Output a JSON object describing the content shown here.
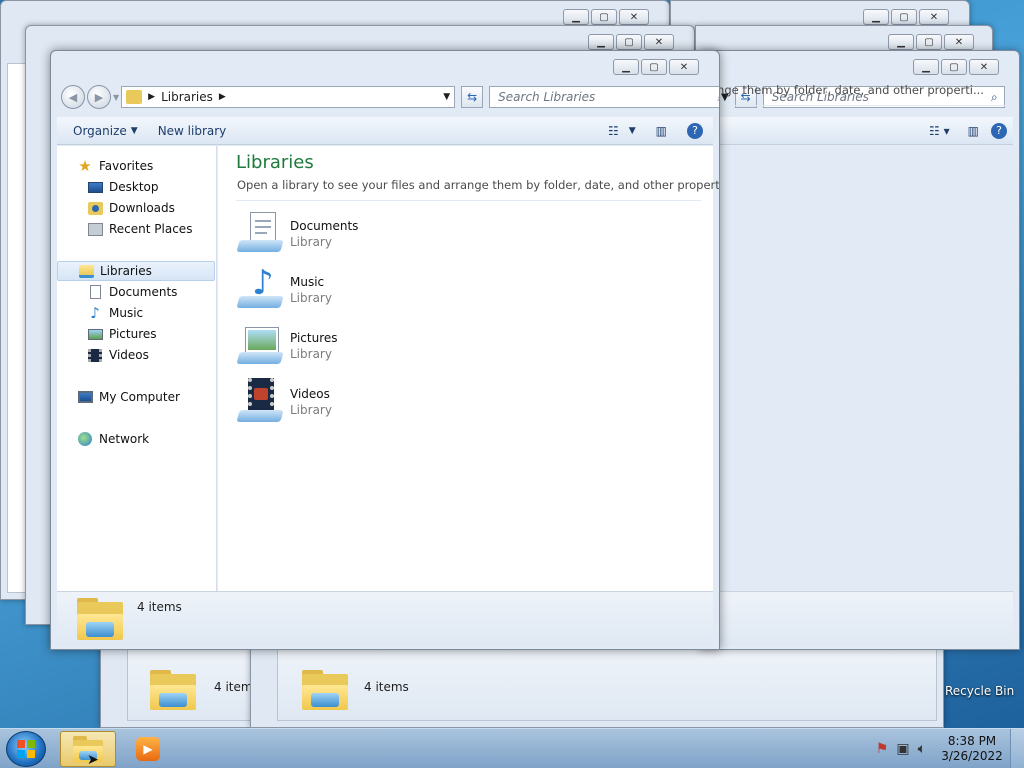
{
  "desktop": {
    "recycle_bin_label": "Recycle Bin"
  },
  "background_windows": {
    "search_placeholder": "Search Libraries",
    "library_subtitle": "Open a library to see your files and arrange them by folder, date, and other properti...",
    "status_count_1": "4 items",
    "status_count_2": "4 items"
  },
  "explorer": {
    "address": {
      "path_label": "Libraries",
      "search_placeholder": "Search Libraries"
    },
    "toolbar": {
      "organize_label": "Organize",
      "new_library_label": "New library"
    },
    "nav": {
      "favorites": "Favorites",
      "desktop": "Desktop",
      "downloads": "Downloads",
      "recent_places": "Recent Places",
      "libraries": "Libraries",
      "documents": "Documents",
      "music": "Music",
      "pictures": "Pictures",
      "videos": "Videos",
      "my_computer": "My Computer",
      "network": "Network"
    },
    "content": {
      "title": "Libraries",
      "subtitle": "Open a library to see your files and arrange them by folder, date, and other properti...",
      "items": [
        {
          "name": "Documents",
          "type": "Library"
        },
        {
          "name": "Music",
          "type": "Library"
        },
        {
          "name": "Pictures",
          "type": "Library"
        },
        {
          "name": "Videos",
          "type": "Library"
        }
      ]
    },
    "status": {
      "count": "4 items"
    }
  },
  "taskbar": {
    "time": "8:38 PM",
    "date": "3/26/2022"
  },
  "colors": {
    "title_green": "#1e7a3c",
    "accent_blue": "#2d67b3"
  }
}
